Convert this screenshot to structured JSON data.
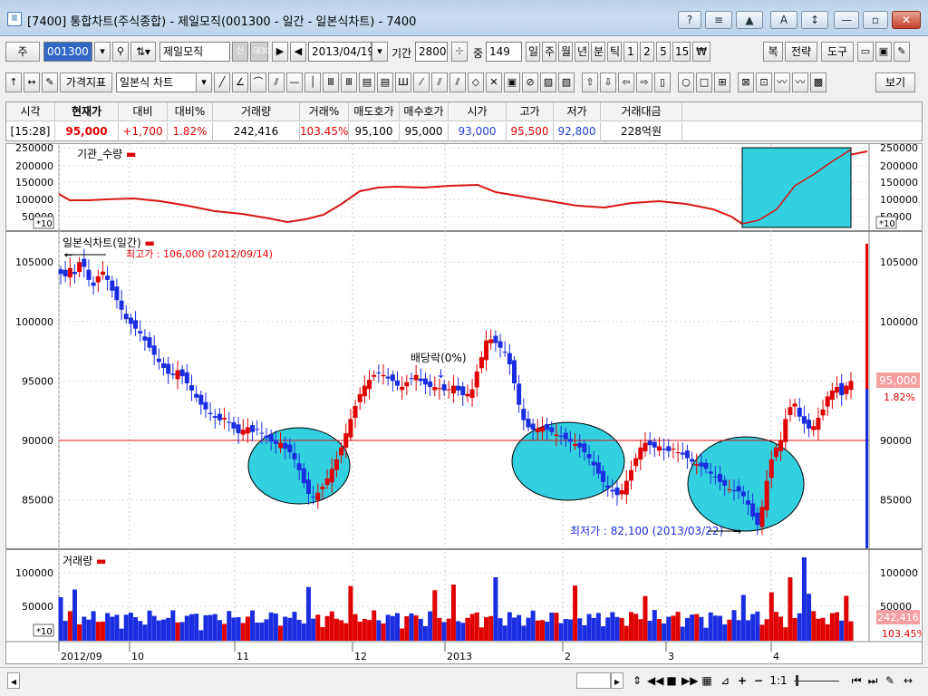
{
  "window": {
    "title": "[7400] 통합차트(주식종합) - 제일모직(001300 - 일간 - 일본식차트) - 7400",
    "buttons": [
      "?",
      "≡",
      "▲",
      "A",
      "↕",
      "—",
      "▫",
      "✕"
    ]
  },
  "toolbar1": {
    "type_btn": "주",
    "code": "001300",
    "name": "제일모직",
    "badge1": "신",
    "badge2": "대30",
    "date": "2013/04/19",
    "period_label": "기간",
    "period_value": "2800",
    "count_label": "중",
    "count_value": "149",
    "interval_buttons": [
      "일",
      "주",
      "월",
      "년",
      "분",
      "틱",
      "1",
      "2",
      "5",
      "15",
      "₩"
    ],
    "right_buttons": [
      "복",
      "전략",
      "도구"
    ]
  },
  "toolbar2": {
    "price_indicator": "가격지표",
    "chart_type": "일본식 차트",
    "view_button": "보기"
  },
  "quote": {
    "headers": [
      "시각",
      "현재가",
      "대비",
      "대비%",
      "거래량",
      "거래%",
      "매도호가",
      "매수호가",
      "시가",
      "고가",
      "저가",
      "거래대금"
    ],
    "values": [
      "[15:28]",
      "95,000",
      "+1,700",
      "1.82%",
      "242,416",
      "103.45%",
      "95,100",
      "95,000",
      "93,000",
      "95,500",
      "92,800",
      "228억원"
    ]
  },
  "institution_panel": {
    "title": "기관_수량",
    "scale_badge": "*10",
    "y_ticks": [
      "250000",
      "200000",
      "150000",
      "100000",
      "50000"
    ]
  },
  "price_panel": {
    "title": "일본식차트(일간)",
    "high_label": "최고가 : 106,000 (2012/09/14)",
    "low_label": "최저가 : 82,100 (2013/03/22)",
    "dividend_label": "배당락(0%)",
    "current_price": "95,000",
    "current_change": "1.82%",
    "y_ticks": [
      "105000",
      "100000",
      "95000",
      "90000",
      "85000"
    ]
  },
  "volume_panel": {
    "title": "거래량",
    "scale_badge": "*10",
    "y_ticks": [
      "100000",
      "50000"
    ],
    "current_volume": "242,416",
    "current_ratio": "103.45%"
  },
  "x_axis": {
    "labels": [
      "2012/09",
      "10",
      "11",
      "12",
      "2013",
      "2",
      "3",
      "4"
    ]
  },
  "bottom": {
    "zoom_label": "1:1"
  },
  "colors": {
    "up": "#e00000",
    "down": "#1a2de0",
    "highlight": "#33d0e0",
    "line": "#d81414"
  },
  "chart_data": {
    "type": "candlestick",
    "y_range": [
      81000,
      107000
    ],
    "reference_line": 90000,
    "high": 106000,
    "low": 82100,
    "closes": [
      104000,
      103800,
      104500,
      104000,
      105000,
      104600,
      103500,
      103000,
      103800,
      104200,
      103500,
      102600,
      101800,
      101000,
      100200,
      99800,
      99400,
      99000,
      98400,
      97800,
      97200,
      96600,
      96100,
      95600,
      95500,
      95900,
      95400,
      94800,
      94200,
      93600,
      93000,
      92600,
      92200,
      91900,
      91700,
      91900,
      91500,
      91000,
      90600,
      90900,
      91100,
      90700,
      90900,
      90600,
      90200,
      89900,
      89700,
      89800,
      89300,
      89000,
      88400,
      87500,
      86400,
      85500,
      85200,
      85600,
      86100,
      86800,
      87600,
      88400,
      89400,
      90600,
      91800,
      92900,
      93900,
      94600,
      95100,
      95500,
      95700,
      95500,
      95200,
      95000,
      94600,
      94500,
      94900,
      95200,
      95500,
      95000,
      94700,
      94500,
      94500,
      94400,
      94200,
      94300,
      94600,
      94200,
      93800,
      93900,
      94300,
      95800,
      97000,
      98400,
      98500,
      98200,
      97800,
      97400,
      96400,
      94800,
      93000,
      91700,
      91100,
      90900,
      91000,
      91100,
      90900,
      90700,
      90500,
      90300,
      90100,
      89900,
      89700,
      89400,
      89000,
      88500,
      87900,
      87200,
      86500,
      86000,
      85700,
      85400,
      85800,
      86600,
      87500,
      88500,
      89400,
      89800,
      89600,
      89400,
      89500,
      89200,
      89100,
      89300,
      89000,
      88800,
      88500,
      88200,
      88000,
      87800,
      87600,
      87200,
      86900,
      86500,
      86200,
      85900,
      85800,
      85700,
      85300,
      84600,
      83600,
      82900,
      84400,
      86600,
      88400,
      89400,
      90000,
      91800,
      92800,
      93100,
      92000,
      91400,
      91000,
      91200,
      91900,
      92600,
      93700,
      94200,
      94500,
      93800,
      94600,
      95000
    ]
  }
}
